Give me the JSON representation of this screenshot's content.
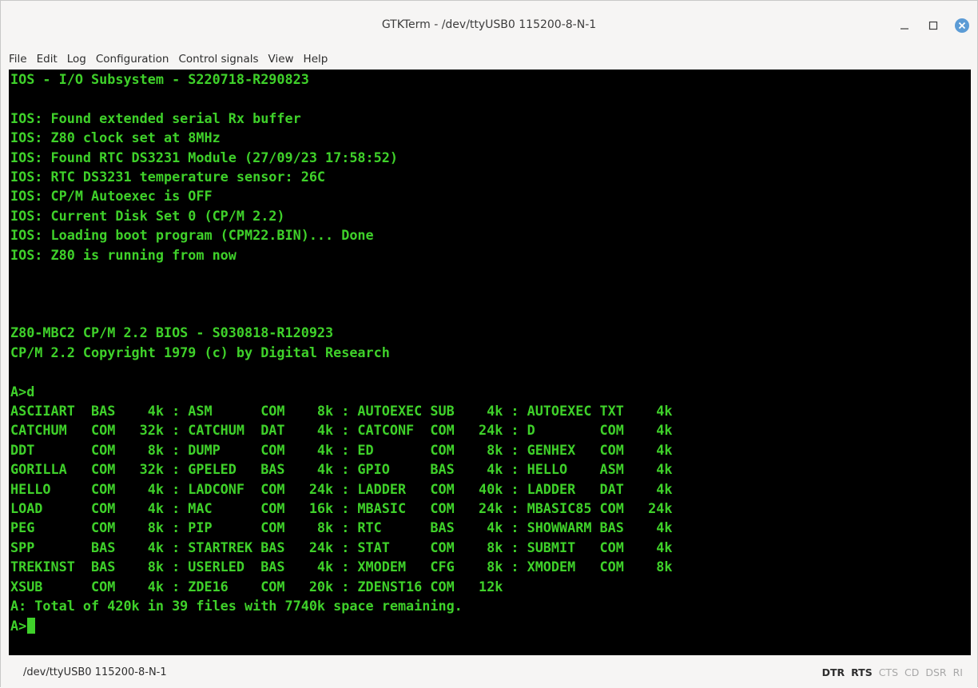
{
  "window": {
    "title": "GTKTerm - /dev/ttyUSB0  115200-8-N-1"
  },
  "menu": [
    {
      "label": "File"
    },
    {
      "label": "Edit"
    },
    {
      "label": "Log"
    },
    {
      "label": "Configuration"
    },
    {
      "label": "Control signals"
    },
    {
      "label": "View"
    },
    {
      "label": "Help"
    }
  ],
  "terminal": {
    "background": "#000000",
    "foreground": "#3fd12a",
    "lines": [
      "IOS - I/O Subsystem - S220718-R290823",
      "",
      "IOS: Found extended serial Rx buffer",
      "IOS: Z80 clock set at 8MHz",
      "IOS: Found RTC DS3231 Module (27/09/23 17:58:52)",
      "IOS: RTC DS3231 temperature sensor: 26C",
      "IOS: CP/M Autoexec is OFF",
      "IOS: Current Disk Set 0 (CP/M 2.2)",
      "IOS: Loading boot program (CPM22.BIN)... Done",
      "IOS: Z80 is running from now",
      "",
      "",
      "",
      "Z80-MBC2 CP/M 2.2 BIOS - S030818-R120923",
      "CP/M 2.2 Copyright 1979 (c) by Digital Research",
      "",
      "A>d",
      "ASCIIART  BAS    4k : ASM      COM    8k : AUTOEXEC SUB    4k : AUTOEXEC TXT    4k",
      "CATCHUM   COM   32k : CATCHUM  DAT    4k : CATCONF  COM   24k : D        COM    4k",
      "DDT       COM    8k : DUMP     COM    4k : ED       COM    8k : GENHEX   COM    4k",
      "GORILLA   COM   32k : GPELED   BAS    4k : GPIO     BAS    4k : HELLO    ASM    4k",
      "HELLO     COM    4k : LADCONF  COM   24k : LADDER   COM   40k : LADDER   DAT    4k",
      "LOAD      COM    4k : MAC      COM   16k : MBASIC   COM   24k : MBASIC85 COM   24k",
      "PEG       COM    8k : PIP      COM    8k : RTC      BAS    4k : SHOWWARM BAS    4k",
      "SPP       BAS    4k : STARTREK BAS   24k : STAT     COM    8k : SUBMIT   COM    4k",
      "TREKINST  BAS    8k : USERLED  BAS    4k : XMODEM   CFG    8k : XMODEM   COM    8k",
      "XSUB      COM    4k : ZDE16    COM   20k : ZDENST16 COM   12k",
      "A: Total of 420k in 39 files with 7740k space remaining."
    ],
    "prompt": "A>"
  },
  "statusbar": {
    "port": "/dev/ttyUSB0  115200-8-N-1",
    "signals": [
      {
        "label": "DTR",
        "active": true
      },
      {
        "label": "RTS",
        "active": true
      },
      {
        "label": "CTS",
        "active": false
      },
      {
        "label": "CD",
        "active": false
      },
      {
        "label": "DSR",
        "active": false
      },
      {
        "label": "RI",
        "active": false
      }
    ]
  }
}
